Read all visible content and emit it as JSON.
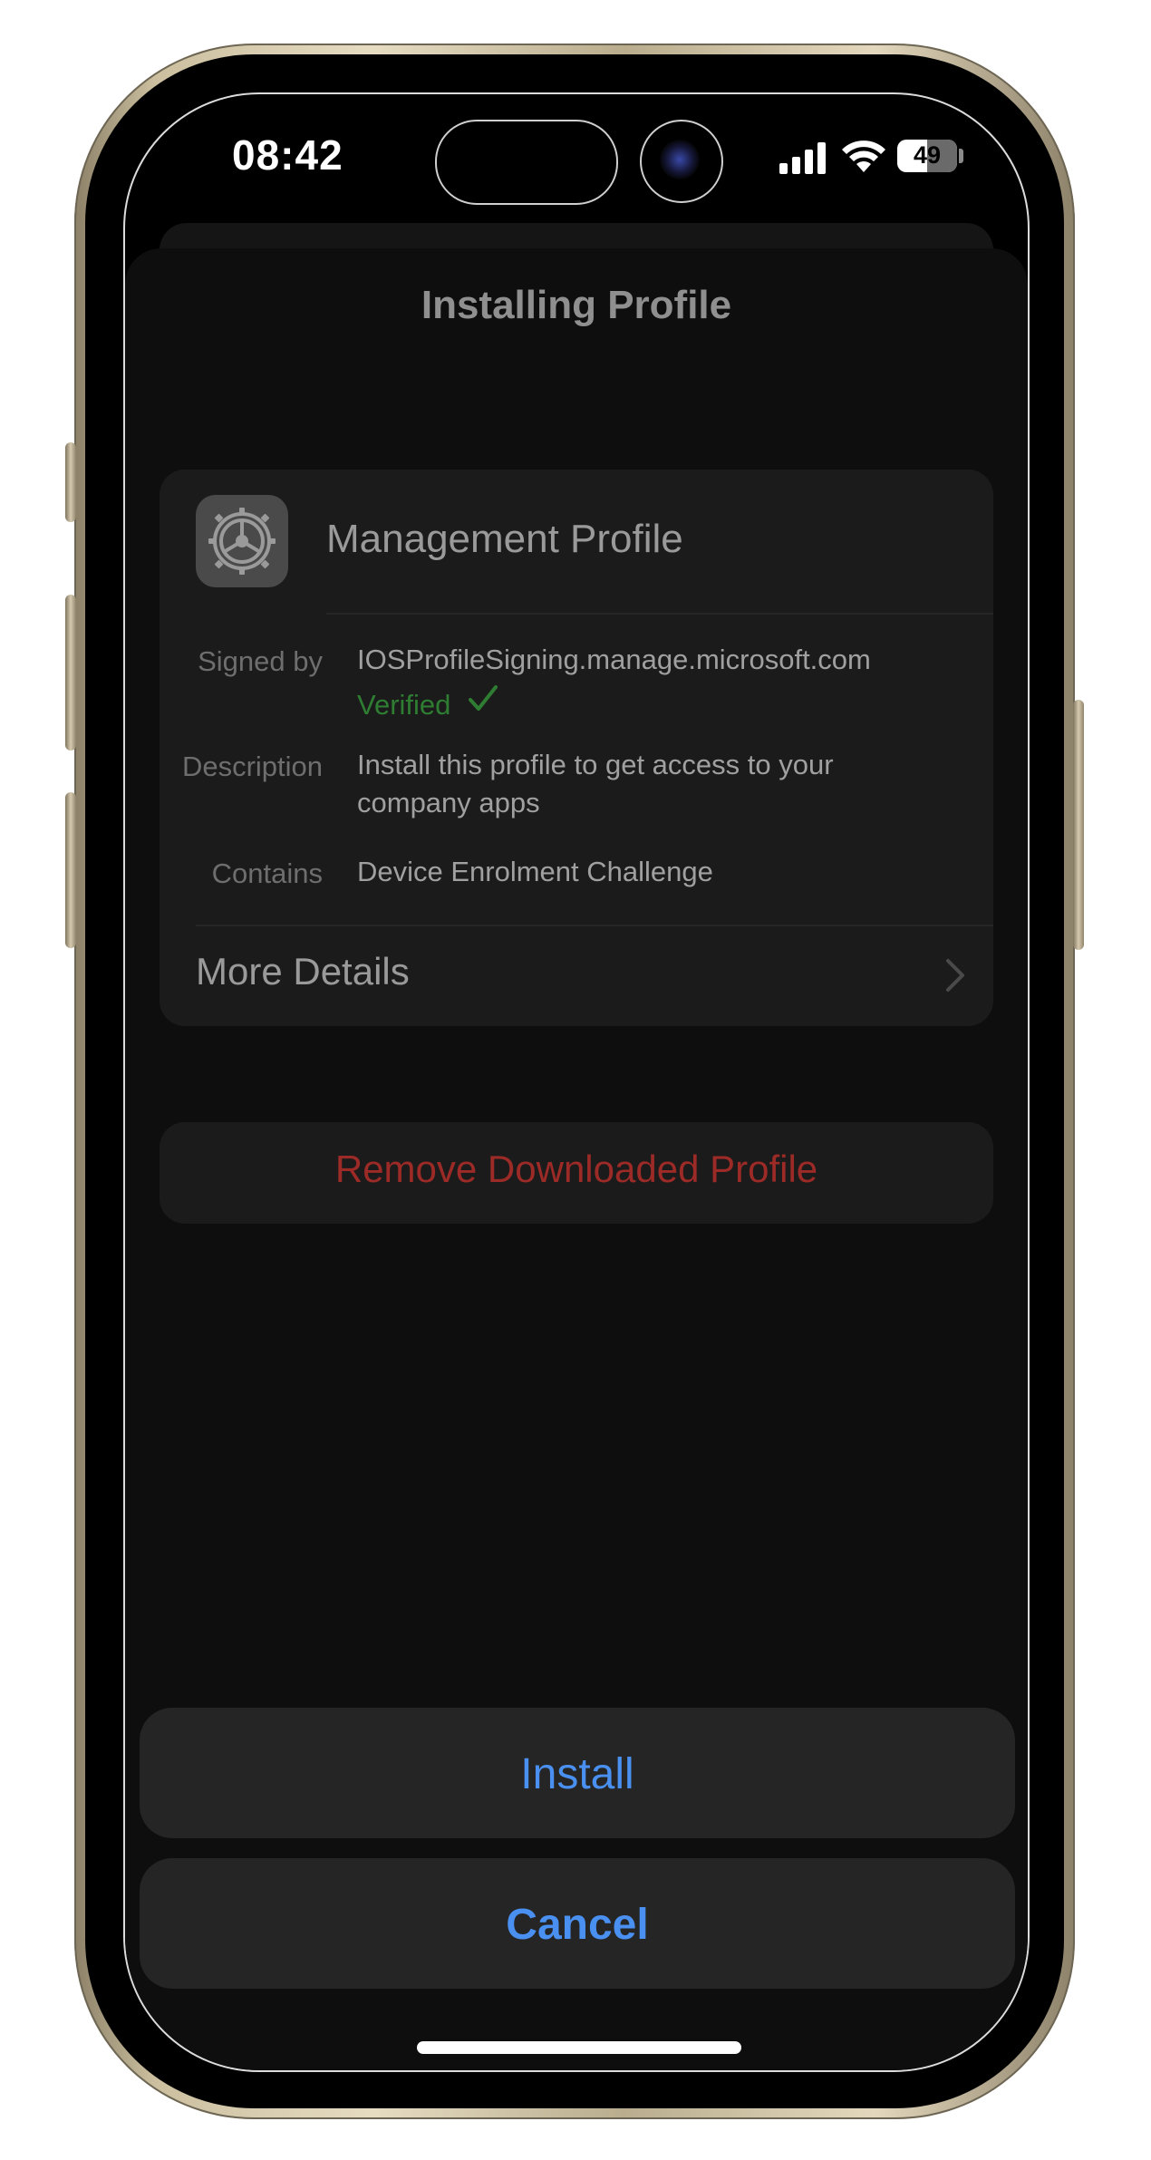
{
  "status_bar": {
    "time": "08:42",
    "battery": "49"
  },
  "sheet": {
    "title": "Installing Profile"
  },
  "profile": {
    "name": "Management Profile",
    "icon": "gear-icon",
    "rows": [
      {
        "label": "Signed by",
        "value": "IOSProfileSigning.manage.microsoft.com",
        "status": "Verified"
      },
      {
        "label": "Description",
        "value": "Install this profile to get access to your company apps"
      },
      {
        "label": "Contains",
        "value": "Device Enrolment Challenge"
      }
    ],
    "more_details": "More Details"
  },
  "remove_label": "Remove Downloaded Profile",
  "actions": {
    "install": "Install",
    "cancel": "Cancel"
  },
  "colors": {
    "accent": "#4a90f0",
    "destructive": "#9c2a26",
    "verified": "#2e7d32"
  }
}
